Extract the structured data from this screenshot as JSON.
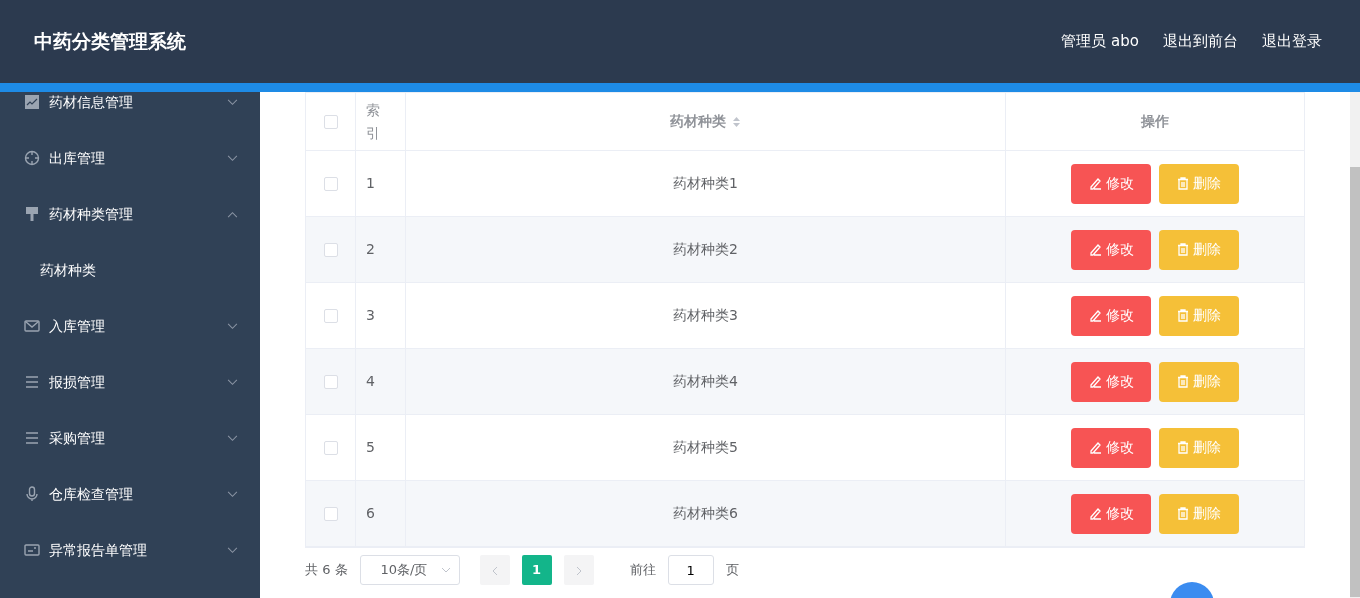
{
  "header": {
    "title": "中药分类管理系统",
    "links": [
      "管理员 abo",
      "退出到前台",
      "退出登录"
    ]
  },
  "sidebar": {
    "items": [
      {
        "label": "药材信息管理",
        "kind": "chart",
        "expanded": false
      },
      {
        "label": "出库管理",
        "kind": "target",
        "expanded": false
      },
      {
        "label": "药材种类管理",
        "kind": "brush",
        "expanded": true,
        "children": [
          {
            "label": "药材种类"
          }
        ]
      },
      {
        "label": "入库管理",
        "kind": "mail",
        "expanded": false
      },
      {
        "label": "报损管理",
        "kind": "list",
        "expanded": false
      },
      {
        "label": "采购管理",
        "kind": "list",
        "expanded": false
      },
      {
        "label": "仓库检查管理",
        "kind": "mic",
        "expanded": false
      },
      {
        "label": "异常报告单管理",
        "kind": "card",
        "expanded": false
      }
    ]
  },
  "table": {
    "columns": [
      "索引",
      "药材种类",
      "操作"
    ],
    "all_checked": false,
    "rows": [
      {
        "index": "1",
        "name": "药材种类1",
        "checked": false,
        "edit": "修改",
        "delete": "删除"
      },
      {
        "index": "2",
        "name": "药材种类2",
        "checked": false,
        "edit": "修改",
        "delete": "删除"
      },
      {
        "index": "3",
        "name": "药材种类3",
        "checked": false,
        "edit": "修改",
        "delete": "删除"
      },
      {
        "index": "4",
        "name": "药材种类4",
        "checked": false,
        "edit": "修改",
        "delete": "删除"
      },
      {
        "index": "5",
        "name": "药材种类5",
        "checked": false,
        "edit": "修改",
        "delete": "删除"
      },
      {
        "index": "6",
        "name": "药材种类6",
        "checked": false,
        "edit": "修改",
        "delete": "删除"
      }
    ]
  },
  "pagination": {
    "total": "共 6 条",
    "page_size": "10条/页",
    "pages": [
      {
        "label": "1",
        "selected": true
      }
    ],
    "goto_label": "前往",
    "goto_value": "1",
    "goto_suffix": "页"
  }
}
